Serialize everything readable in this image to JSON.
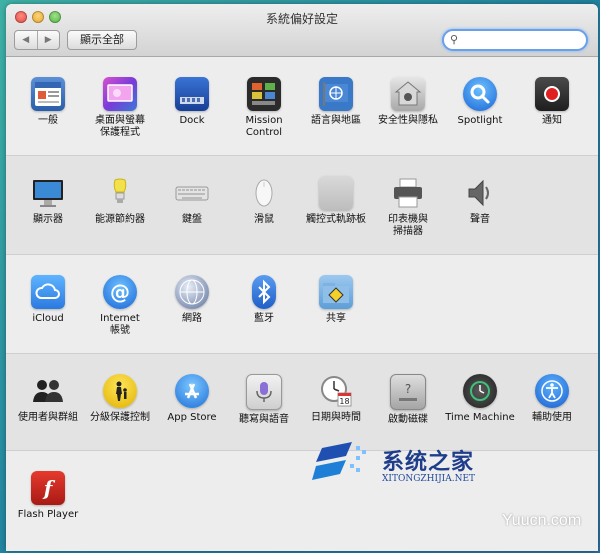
{
  "window": {
    "title": "系統偏好設定"
  },
  "toolbar": {
    "back_glyph": "◀",
    "forward_glyph": "▶",
    "show_all_label": "顯示全部",
    "search_placeholder": "",
    "search_value": ""
  },
  "sections": [
    {
      "items": [
        {
          "label": "一般",
          "icon": "general-icon"
        },
        {
          "label": "桌面與螢幕\n保護程式",
          "icon": "desktop-screensaver-icon"
        },
        {
          "label": "Dock",
          "icon": "dock-icon"
        },
        {
          "label": "Mission\nControl",
          "icon": "mission-control-icon"
        },
        {
          "label": "語言與地區",
          "icon": "language-region-icon"
        },
        {
          "label": "安全性與隱私",
          "icon": "security-privacy-icon"
        },
        {
          "label": "Spotlight",
          "icon": "spotlight-icon"
        },
        {
          "label": "通知",
          "icon": "notifications-icon"
        }
      ]
    },
    {
      "items": [
        {
          "label": "顯示器",
          "icon": "displays-icon"
        },
        {
          "label": "能源節約器",
          "icon": "energy-saver-icon"
        },
        {
          "label": "鍵盤",
          "icon": "keyboard-icon"
        },
        {
          "label": "滑鼠",
          "icon": "mouse-icon"
        },
        {
          "label": "觸控式軌跡板",
          "icon": "trackpad-icon"
        },
        {
          "label": "印表機與\n掃描器",
          "icon": "printer-scanner-icon"
        },
        {
          "label": "聲音",
          "icon": "sound-icon"
        }
      ]
    },
    {
      "items": [
        {
          "label": "iCloud",
          "icon": "icloud-icon"
        },
        {
          "label": "Internet\n帳號",
          "icon": "internet-accounts-icon"
        },
        {
          "label": "網路",
          "icon": "network-icon"
        },
        {
          "label": "藍牙",
          "icon": "bluetooth-icon"
        },
        {
          "label": "共享",
          "icon": "sharing-icon"
        }
      ]
    },
    {
      "items": [
        {
          "label": "使用者與群組",
          "icon": "users-groups-icon"
        },
        {
          "label": "分級保護控制",
          "icon": "parental-controls-icon"
        },
        {
          "label": "App Store",
          "icon": "app-store-icon"
        },
        {
          "label": "聽寫與語音",
          "icon": "dictation-speech-icon"
        },
        {
          "label": "日期與時間",
          "icon": "date-time-icon"
        },
        {
          "label": "啟動磁碟",
          "icon": "startup-disk-icon"
        },
        {
          "label": "Time Machine",
          "icon": "time-machine-icon"
        },
        {
          "label": "輔助使用",
          "icon": "accessibility-icon"
        }
      ]
    },
    {
      "items": [
        {
          "label": "Flash Player",
          "icon": "flash-player-icon"
        }
      ]
    }
  ],
  "watermark": {
    "name": "系统之家",
    "url": "XITONGZHIJIA.NET",
    "corner": "Yuucn.com"
  }
}
